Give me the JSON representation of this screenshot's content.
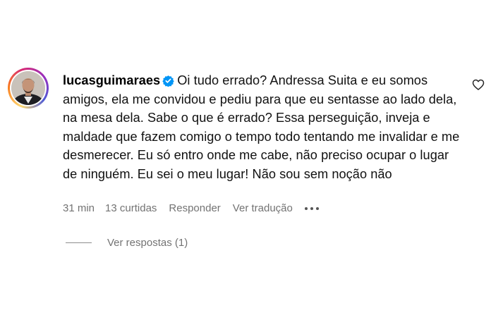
{
  "comment": {
    "username": "lucasguimaraes",
    "verified_icon": "verified-badge-icon",
    "text": "Oi tudo errado? Andressa Suita e eu somos amigos, ela me convidou e pediu para que eu sentasse ao lado dela, na mesa dela. Sabe o que é errado? Essa perseguição, inveja e maldade que fazem comigo o tempo todo tentando me invalidar e me desmerecer. Eu só entro onde me cabe, não preciso ocupar o lugar de ninguém. Eu sei o meu lugar! Não sou sem noção não",
    "time": "31 min",
    "likes": "13 curtidas",
    "reply_label": "Responder",
    "translate_label": "Ver tradução",
    "more_icon": "more-options-icon",
    "like_icon": "heart-outline-icon",
    "view_replies_label": "Ver respostas (1)"
  },
  "colors": {
    "meta_text": "#737373",
    "verified_blue": "#0095f6",
    "text": "#111111"
  }
}
